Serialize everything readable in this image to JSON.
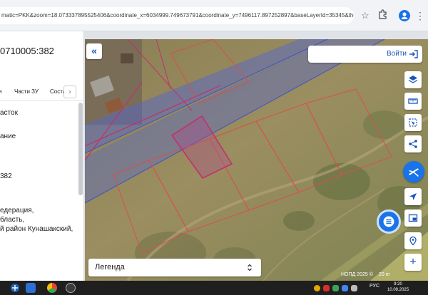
{
  "browser": {
    "url": "matic=PKK&zoom=18.073337895525406&coordinate_x=6034999.749673791&coordinate_y=7496117.897252897&baseLayerId=35345&theme_i...",
    "star_icon": "star-outline-icon",
    "extensions_icon": "puzzle-icon",
    "profile_icon": "person-icon",
    "menu_icon": "kebab-icon"
  },
  "panel": {
    "cadastral_number": "0710005:382",
    "tabs": [
      "Части ЗУ",
      "Соста"
    ],
    "tab_left_partial": "",
    "tab_arrow": "›",
    "lines": [
      "асток",
      "ание",
      "382",
      "едерация,",
      "бласть,",
      "й район Кунашакский,"
    ]
  },
  "map": {
    "collapse_icon": "«",
    "login_label": "Войти",
    "login_icon": "login-arrow-icon",
    "tools": [
      "layers-icon",
      "ruler-icon",
      "select-area-icon",
      "share-icon",
      "cadastre-logo-icon",
      "locate-icon",
      "picture-in-picture-icon",
      "pin-icon",
      "zoom-in-icon"
    ],
    "zoom_in_label": "+",
    "fab_icon": "list-menu-icon",
    "legend_label": "Легенда",
    "attribution": "НОПД 2025 ©",
    "scale": "20 m"
  },
  "taskbar": {
    "tray_lang": "РУС",
    "time": "9:20",
    "date": "10.09.2025"
  },
  "colors": {
    "accent": "#1a55b8",
    "parcel_outline": "#c2306e",
    "overlay_blue": "#5b6fe0",
    "taskbar": "#1f1f1f"
  }
}
